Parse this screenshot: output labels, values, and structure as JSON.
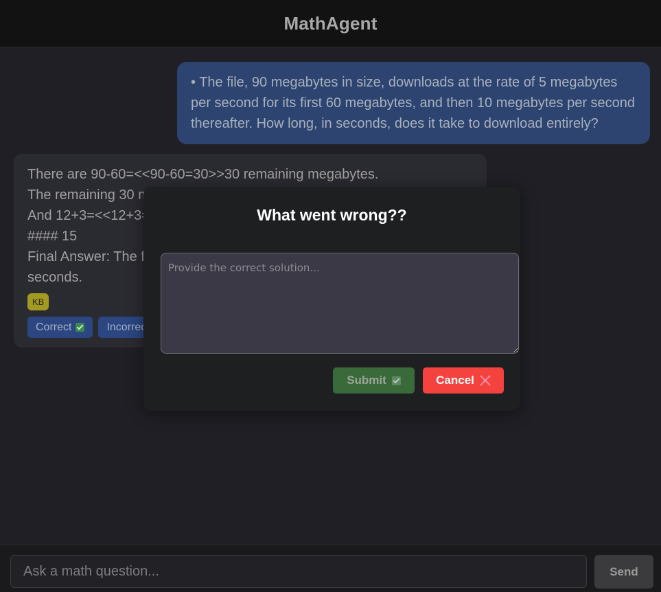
{
  "header": {
    "title": "MathAgent"
  },
  "user_message": {
    "text": "• The file, 90 megabytes in size, downloads at the rate of 5 megabytes per second for its first 60 megabytes, and then 10 megabytes per second thereafter. How long, in seconds, does it take to download entirely?"
  },
  "bot_message": {
    "lines": [
      "There are 90-60=<<90-60=30>>30 remaining megabytes.",
      "The remaining 30 m",
      "And 12+3=<<12+3=",
      "#### 15",
      "Final Answer: The f",
      "seconds."
    ],
    "badge": "KB",
    "correct_label": "Correct",
    "incorrect_label": "Incorrect"
  },
  "modal": {
    "title": "What went wrong??",
    "textarea_placeholder": "Provide the correct solution...",
    "textarea_value": "",
    "submit_label": "Submit",
    "cancel_label": "Cancel"
  },
  "footer": {
    "input_placeholder": "Ask a math question...",
    "input_value": "",
    "send_label": "Send"
  },
  "colors": {
    "user_bubble": "#2d4470",
    "badge": "#a39a20",
    "submit": "#3a693a",
    "cancel": "#f4433f"
  },
  "icons": {
    "check": "check-box-icon",
    "close": "x-icon"
  }
}
